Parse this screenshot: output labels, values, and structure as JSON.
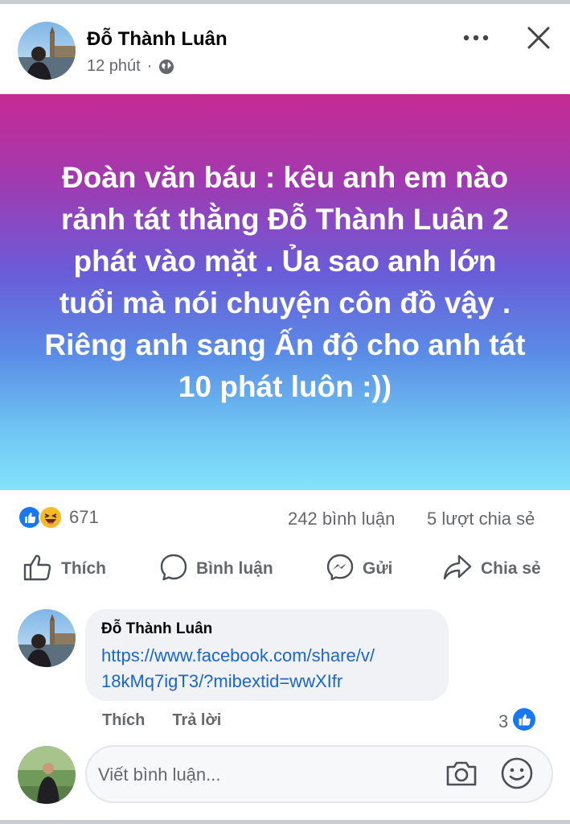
{
  "post": {
    "author_name": "Đỗ Thành Luân",
    "time": "12 phút",
    "separator": "·",
    "visibility_icon": "globe-icon",
    "banner_text": "Đoàn văn báu : kêu anh em nào rảnh tát thằng Đỗ Thành Luân 2 phát vào mặt . Ủa sao anh lớn tuổi mà nói chuyện côn đồ vậy . Riêng anh sang Ấn độ cho anh tát 10 phát luôn :))",
    "banner_colors": {
      "top": "#c62a93",
      "middle": "#6a5cd8",
      "bottom": "#84e3fb"
    }
  },
  "header_icons": {
    "more": "more-horizontal-icon",
    "close": "close-icon"
  },
  "stats": {
    "reaction_icons": [
      "like-reaction-icon",
      "haha-reaction-icon"
    ],
    "reaction_count": "671",
    "comments": "242 bình luận",
    "shares": "5 lượt chia sẻ"
  },
  "actions": {
    "like_label": "Thích",
    "comment_label": "Bình luận",
    "send_label": "Gửi",
    "share_label": "Chia sẻ"
  },
  "comment": {
    "author_name": "Đỗ Thành Luân",
    "link_line1": "https://www.facebook.com/share/v/",
    "link_line2": "18kMq7igT3/?mibextid=wwXIfr",
    "like_label": "Thích",
    "reply_label": "Trả lời",
    "like_count": "3"
  },
  "composer": {
    "placeholder": "Viết bình luận..."
  },
  "colors": {
    "link": "#1b66c9",
    "secondary_text": "#65676b",
    "like_blue": "#1877f2"
  }
}
